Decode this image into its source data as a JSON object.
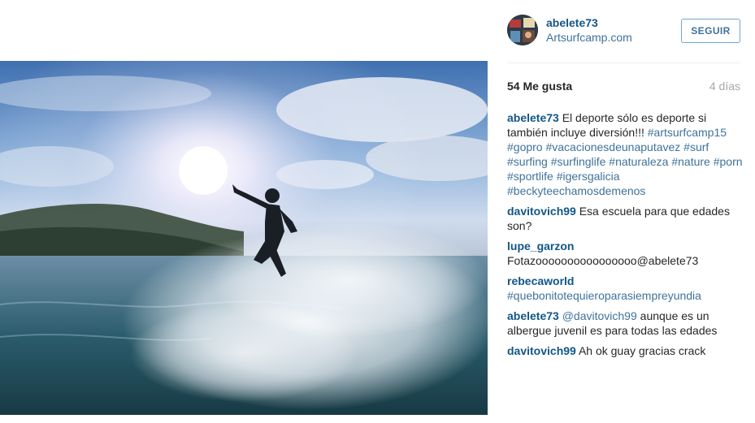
{
  "photo": {
    "alt": ""
  },
  "post": {
    "username": "abelete73",
    "site": "Artsurfcamp.com",
    "follow_label": "SEGUIR",
    "likes": "54 Me gusta",
    "time": "4 días"
  },
  "caption": {
    "user": "abelete73",
    "text": "El deporte sólo es deporte si también incluye diversión!!!",
    "tags": [
      "#artsurfcamp15",
      "#gopro",
      "#vacacionesdeunaputavez",
      "#surf",
      "#surfing",
      "#surfinglife",
      "#naturaleza",
      "#nature",
      "#porn",
      "#sportlife",
      "#igersgalicia",
      "#beckyteechamosdemenos"
    ]
  },
  "comments": [
    {
      "user": "davitovich99",
      "text": "Esa escuela para que edades son?",
      "mention": ""
    },
    {
      "user": "lupe_garzon",
      "text": "Fotazoooooooooooooooo@abelete73",
      "mention": ""
    },
    {
      "user": "rebecaworld",
      "text": "",
      "mention": "#quebonitotequieroparasiempreyundia"
    },
    {
      "user": "abelete73",
      "text": "aunque es un albergue juvenil es para todas las edades",
      "mention": "@davitovich99"
    },
    {
      "user": "davitovich99",
      "text": "Ah ok guay gracias crack",
      "mention": ""
    }
  ],
  "colors": {
    "user": "#125688",
    "link": "#3f729b",
    "muted": "#a5a7aa",
    "button_border": "#70a4d2"
  }
}
